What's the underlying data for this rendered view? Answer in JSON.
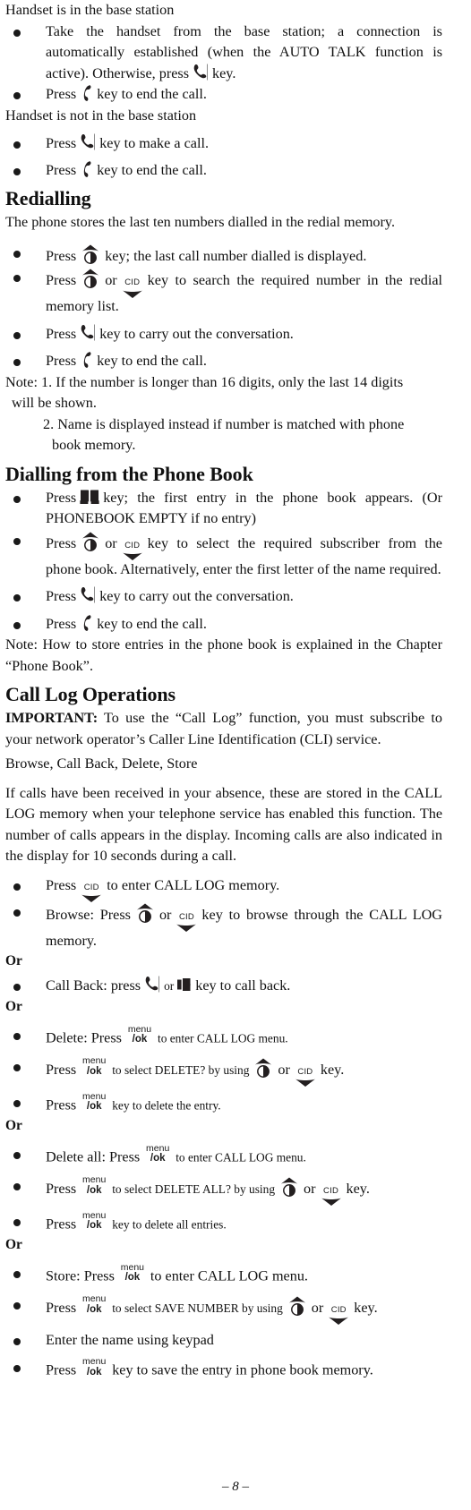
{
  "document": {
    "page_footer": "– 8 –",
    "page_number": "8"
  },
  "icons": {
    "talk": "talk-handset-icon",
    "end": "end-call-handset-icon",
    "up": "up-redial-key-icon",
    "cid_down": "cid-down-key-icon",
    "cid_label": "CID",
    "phonebook": "phone-book-icon",
    "speaker": "speakerphone-icon",
    "menu_ok_top": "menu",
    "menu_ok_bottom": "/ok"
  },
  "sections": {
    "handset_in_base": {
      "heading": "Handset is in the base station",
      "bullet_1_part1": "Take the handset from the base station; a connection is automatically established (when the AUTO TALK function is active). Otherwise, press",
      "bullet_1_part2": "key.",
      "bullet_2_part1": "Press",
      "bullet_2_part2": "key to end the call."
    },
    "handset_not_in_base": {
      "heading": "Handset is not in the base station",
      "bullet_1_part1": "Press",
      "bullet_1_part2": "key to make a call.",
      "bullet_2_part1": "Press",
      "bullet_2_part2": "key to end the call."
    },
    "redialling": {
      "heading": "Redialling",
      "intro": "The phone stores the last ten numbers dialled in the redial memory.",
      "bullet_1_part1": "Press",
      "bullet_1_part2": "key; the last call number dialled is displayed.",
      "bullet_2_part1": "Press",
      "bullet_2_mid": "or",
      "bullet_2_part2": "key to search the required number in the redial memory list.",
      "bullet_3_part1": "Press",
      "bullet_3_part2": "key to carry out the conversation.",
      "bullet_4_part1": "Press",
      "bullet_4_part2": "key to end the call.",
      "note_1": "Note: 1. If the number is longer than 16 digits, only the last 14 digits",
      "note_1_cont": "will be shown.",
      "note_2": "2. Name is displayed instead if number is matched with phone",
      "note_2_cont": "book memory."
    },
    "dialling_phone_book": {
      "heading": "Dialling from the Phone Book",
      "bullet_1_part1": "Press",
      "bullet_1_part2": "key; the first entry in the phone book appears. (Or PHONEBOOK EMPTY if no entry)",
      "bullet_2_part1": "Press",
      "bullet_2_mid": "or",
      "bullet_2_part2": "key to select the required subscriber from the phone book. Alternatively, enter the first letter of the name required.",
      "bullet_3_part1": "Press",
      "bullet_3_part2": "key to carry out the conversation.",
      "bullet_4_part1": "Press",
      "bullet_4_part2": "key to end the call.",
      "note": "Note: How to store entries in the phone book is explained in the Chapter “Phone Book”."
    },
    "call_log": {
      "heading": "Call Log Operations",
      "important_label": "IMPORTANT:",
      "important_text": " To use the “Call Log” function, you must subscribe to your network operator’s Caller Line Identification (CLI) service.",
      "subtitle": "Browse, Call Back, Delete, Store",
      "intro": "If calls have been received in your absence, these are stored in the CALL LOG memory when your telephone service has enabled this function. The number of calls appears in the display. Incoming calls are also indicated in the display for 10 seconds during a call.",
      "enter_part1": "Press",
      "enter_part2": "to enter CALL LOG memory.",
      "browse_part1": "Browse: Press",
      "browse_mid": "or",
      "browse_part2": "key to browse through the CALL LOG memory.",
      "or_1": "Or",
      "callback_part1": "Call Back: press",
      "callback_mid": "or",
      "callback_part2": "key to call back.",
      "or_2": "Or",
      "delete": {
        "b1_part1": "Delete: Press",
        "b1_part2": "to enter CALL LOG menu.",
        "b2_part1": "Press",
        "b2_part2": "to select DELETE? by using",
        "b2_mid": "or",
        "b2_part3": "key.",
        "b3_part1": "Press",
        "b3_part2": "key to delete the entry."
      },
      "or_3": "Or",
      "delete_all": {
        "b1_part1": "Delete all: Press",
        "b1_part2": "to enter CALL LOG menu.",
        "b2_part1": "Press",
        "b2_part2": "to select DELETE ALL? by using",
        "b2_mid": "or",
        "b2_part3": "key.",
        "b3_part1": "Press",
        "b3_part2": "key to delete all entries."
      },
      "or_4": "Or",
      "store": {
        "b1_part1": "Store: Press",
        "b1_part2": "to enter CALL LOG menu.",
        "b2_part1": "Press",
        "b2_part2": "to select SAVE NUMBER by using",
        "b2_mid": "or",
        "b2_part3": "key.",
        "b3": "Enter the name using keypad",
        "b4_part1": "Press",
        "b4_part2": "key to save the entry in phone book memory."
      }
    }
  }
}
